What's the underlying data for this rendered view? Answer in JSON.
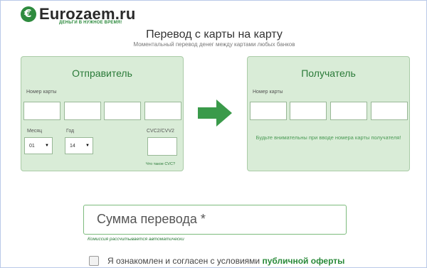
{
  "brand": {
    "logo_letter": "€",
    "name": "Eurozaem.ru",
    "tagline": "ДЕНЬГИ В НУЖНОЕ ВРЕМЯ!"
  },
  "page": {
    "title": "Перевод с карты на карту",
    "subtitle": "Моментальный перевод денег между картами любых банков"
  },
  "sender": {
    "title": "Отправитель",
    "card_number_label": "Номер карты",
    "card_segments": [
      "",
      "",
      "",
      ""
    ],
    "month_label": "Месяц",
    "month_value": "01",
    "year_label": "Год",
    "year_value": "14",
    "cvc_label": "CVC2/CVV2",
    "cvc_value": "",
    "cvc_help_link": "Что такое CVC?"
  },
  "receiver": {
    "title": "Получатель",
    "card_number_label": "Номер карты",
    "card_segments": [
      "",
      "",
      "",
      ""
    ],
    "note": "Будьте внимательны при вводе номера карты получателя!"
  },
  "amount": {
    "placeholder": "Сумма перевода *",
    "commission_note": "Комиссия рассчитывается автоматически"
  },
  "agreement": {
    "text": "Я ознакомлен и согласен с условиями",
    "link_text": "публичной оферты",
    "checked": false
  },
  "colors": {
    "accent": "#2a7a38",
    "panel_bg": "#d9ecd7",
    "arrow": "#3a9a4a"
  },
  "icons": {
    "arrow": "right-arrow-icon",
    "select_caret": "caret-down-icon"
  }
}
